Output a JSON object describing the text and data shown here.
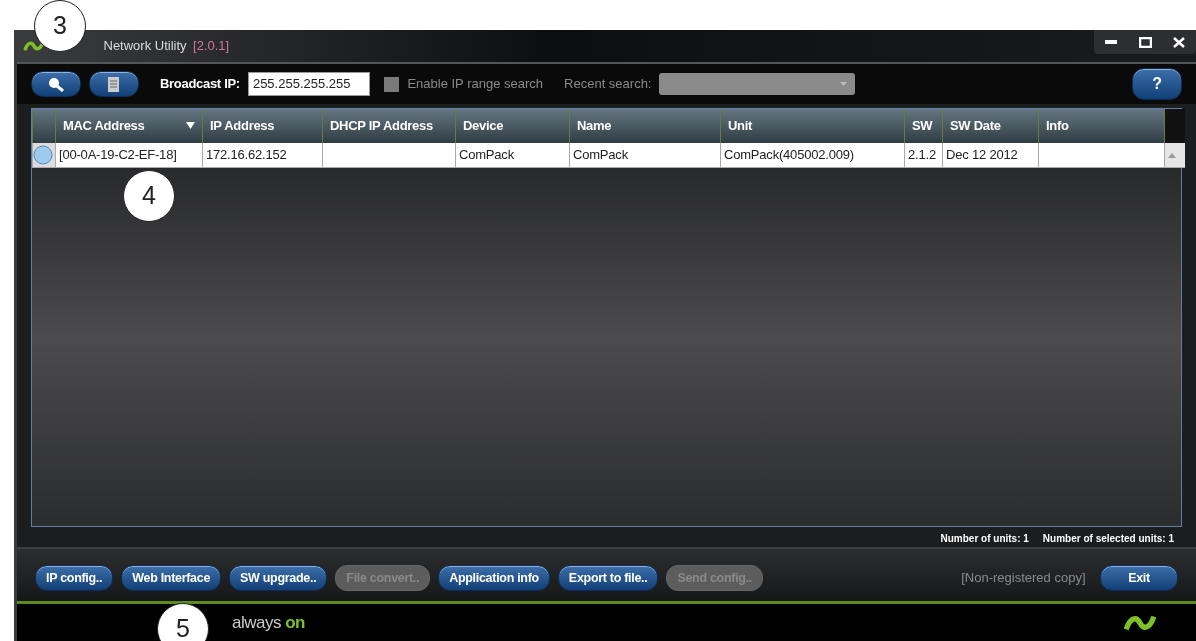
{
  "window": {
    "title": "Network Utility",
    "version": "[2.0.1]"
  },
  "toolbar": {
    "broadcast_label": "Broadcast IP:",
    "broadcast_value": "255.255.255.255",
    "range_search": {
      "label": "Enable IP range search",
      "checked": false
    },
    "recent_label": "Recent search:",
    "help": "?"
  },
  "table": {
    "columns": [
      {
        "label": "MAC Address",
        "sorted": true
      },
      {
        "label": "IP Address",
        "sorted": false
      },
      {
        "label": "DHCP IP Address",
        "sorted": false
      },
      {
        "label": "Device",
        "sorted": false
      },
      {
        "label": "Name",
        "sorted": false
      },
      {
        "label": "Unit",
        "sorted": false
      },
      {
        "label": "SW",
        "sorted": false
      },
      {
        "label": "SW Date",
        "sorted": false
      },
      {
        "label": "Info",
        "sorted": false
      }
    ],
    "rows": [
      {
        "cells": [
          "[00-0A-19-C2-EF-18]",
          "172.16.62.152",
          "",
          "ComPack",
          "ComPack",
          "ComPack(405002.009)",
          "2.1.2",
          "Dec 12 2012",
          ""
        ]
      }
    ]
  },
  "status": {
    "units": "Number of units: 1",
    "selected_units": "Number of selected units: 1"
  },
  "buttons": [
    {
      "label": "IP config..",
      "disabled": false
    },
    {
      "label": "Web Interface",
      "disabled": false
    },
    {
      "label": "SW upgrade..",
      "disabled": false
    },
    {
      "label": "File convert..",
      "disabled": true
    },
    {
      "label": "Application info",
      "disabled": false
    },
    {
      "label": "Export to file..",
      "disabled": false
    },
    {
      "label": "Send config..",
      "disabled": true
    }
  ],
  "registration": "[Non-registered copy]",
  "exit": "Exit",
  "footer": {
    "brand_a": "always",
    "brand_b": "on"
  },
  "callouts": [
    "3",
    "4",
    "5"
  ]
}
